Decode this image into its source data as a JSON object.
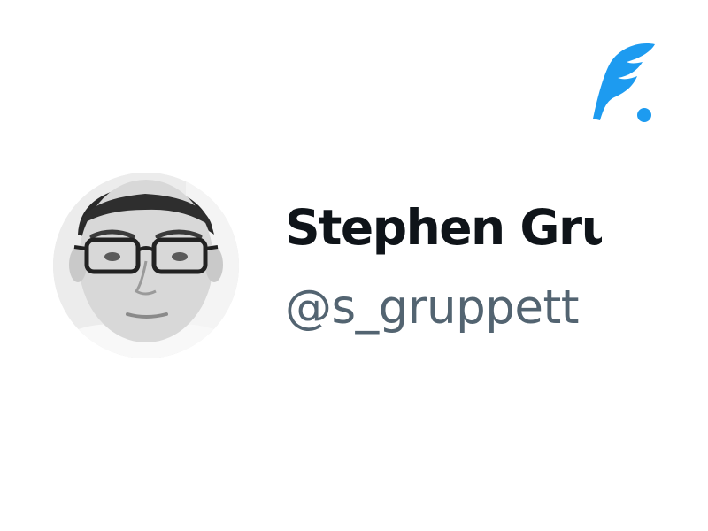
{
  "profile": {
    "display_name": "Stephen Gru",
    "handle": "@s_gruppett"
  },
  "logo": {
    "icon": "quill-feather-icon",
    "color": "#1d9bf0"
  },
  "avatar": {
    "icon": "profile-photo"
  },
  "colors": {
    "name": "#0f1419",
    "handle": "#536471",
    "accent": "#1d9bf0"
  }
}
